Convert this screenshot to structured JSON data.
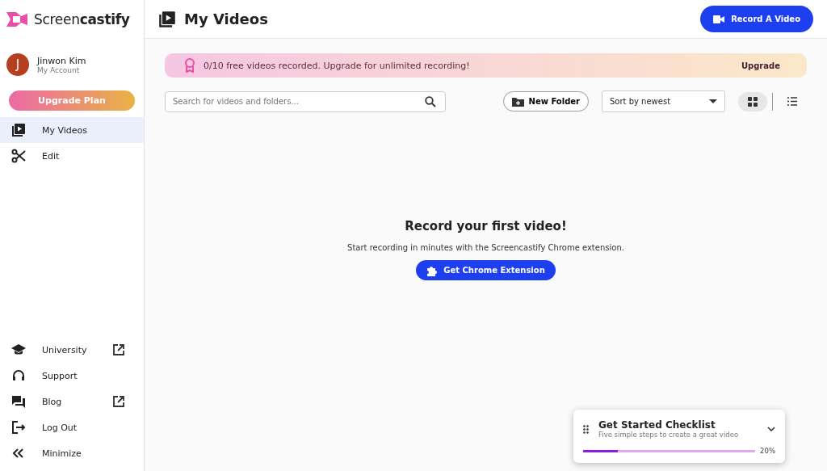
{
  "logo": "Screen**castify**",
  "account": {
    "initial": "J",
    "name": "Jinwon Kim",
    "subtitle": "My Account"
  },
  "upgrade_plan": "Upgrade Plan",
  "nav": [
    {
      "label": "My Videos",
      "selected": true
    },
    {
      "label": "Edit",
      "selected": false
    }
  ],
  "footer_nav": [
    {
      "label": "University",
      "external": true
    },
    {
      "label": "Support",
      "external": false
    },
    {
      "label": "Blog",
      "external": true
    },
    {
      "label": "Log Out",
      "external": false
    },
    {
      "label": "Minimize",
      "external": false
    }
  ],
  "header": {
    "title": "My Videos",
    "record_button": "Record A Video"
  },
  "banner": {
    "text": "0/10 free videos recorded. Upgrade for unlimited recording!",
    "action": "Upgrade"
  },
  "search": {
    "placeholder": "Search for videos and folders..."
  },
  "new_folder": "New Folder",
  "sort": {
    "value": "Sort by newest"
  },
  "views": [
    {
      "kind": "grid",
      "selected": true
    },
    {
      "kind": "list",
      "selected": false
    }
  ],
  "empty": {
    "title": "Record your first video!",
    "text": "Start recording in minutes with the Screencastify Chrome extension.",
    "button": "Get Chrome Extension"
  },
  "checklist": {
    "title": "Get Started Checklist",
    "subtitle": "Five simple steps to create a great video",
    "level": 0.2,
    "reading": "20%"
  }
}
